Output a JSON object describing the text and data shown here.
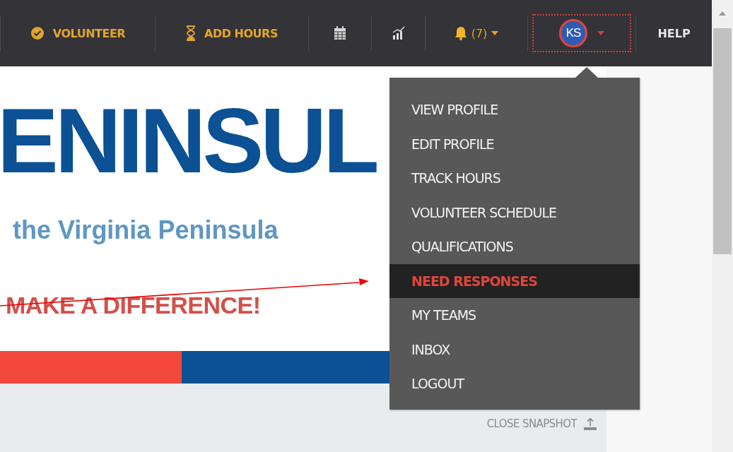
{
  "navbar": {
    "items": [
      {
        "kind": "link",
        "label": "VOLUNTEER"
      },
      {
        "kind": "link",
        "label": "ADD HOURS"
      },
      {
        "kind": "icon"
      },
      {
        "kind": "icon"
      },
      {
        "kind": "notifications",
        "label": "(7)"
      },
      {
        "kind": "avatar",
        "label": "KS"
      },
      {
        "kind": "text",
        "label": "HELP"
      }
    ]
  },
  "banner": {
    "title": "ENINSUL",
    "subtitle": "the Virginia Peninsula",
    "slogan": "MAKE A DIFFERENCE!"
  },
  "profile_menu": {
    "items": [
      {
        "label": "VIEW PROFILE",
        "selected": false
      },
      {
        "label": "EDIT PROFILE",
        "selected": false
      },
      {
        "label": "TRACK HOURS",
        "selected": false
      },
      {
        "label": "VOLUNTEER SCHEDULE",
        "selected": false
      },
      {
        "label": "QUALIFICATIONS",
        "selected": false
      },
      {
        "label": "NEED RESPONSES",
        "selected": true
      },
      {
        "label": "MY TEAMS",
        "selected": false
      },
      {
        "label": "INBOX",
        "selected": false
      },
      {
        "label": "LOGOUT",
        "selected": false
      }
    ]
  },
  "snapshot": {
    "close_label": "CLOSE SNAPSHOT"
  }
}
